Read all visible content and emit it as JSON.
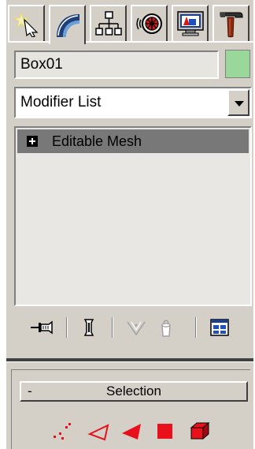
{
  "tabs": [
    {
      "id": "create",
      "icon": "create-star-cursor-icon"
    },
    {
      "id": "modify",
      "icon": "modify-arc-icon"
    },
    {
      "id": "hierarchy",
      "icon": "hierarchy-tree-icon"
    },
    {
      "id": "motion",
      "icon": "motion-wheel-icon"
    },
    {
      "id": "display",
      "icon": "display-monitor-icon"
    },
    {
      "id": "utilities",
      "icon": "utilities-hammer-icon"
    }
  ],
  "active_tab": "modify",
  "object": {
    "name": "Box01",
    "color": "#9ad79a"
  },
  "modifier_list": {
    "label": "Modifier List"
  },
  "stack": {
    "items": [
      {
        "label": "Editable Mesh",
        "expand_symbol": "+"
      }
    ]
  },
  "stack_toolbar": [
    {
      "icon": "pin-stack-icon",
      "enabled": true
    },
    {
      "icon": "show-end-result-icon",
      "enabled": true
    },
    {
      "icon": "make-unique-icon",
      "enabled": false
    },
    {
      "icon": "remove-modifier-icon",
      "enabled": false
    },
    {
      "icon": "configure-modifier-sets-icon",
      "enabled": true
    }
  ],
  "selection_rollout": {
    "collapse_symbol": "-",
    "title": "Selection",
    "levels": [
      {
        "icon": "vertex-icon"
      },
      {
        "icon": "edge-icon"
      },
      {
        "icon": "face-icon"
      },
      {
        "icon": "polygon-icon"
      },
      {
        "icon": "element-icon"
      }
    ]
  },
  "colors": {
    "panel": "#d4d0c8",
    "stack_highlight": "#787878",
    "subobject_red": "#e8101a"
  }
}
